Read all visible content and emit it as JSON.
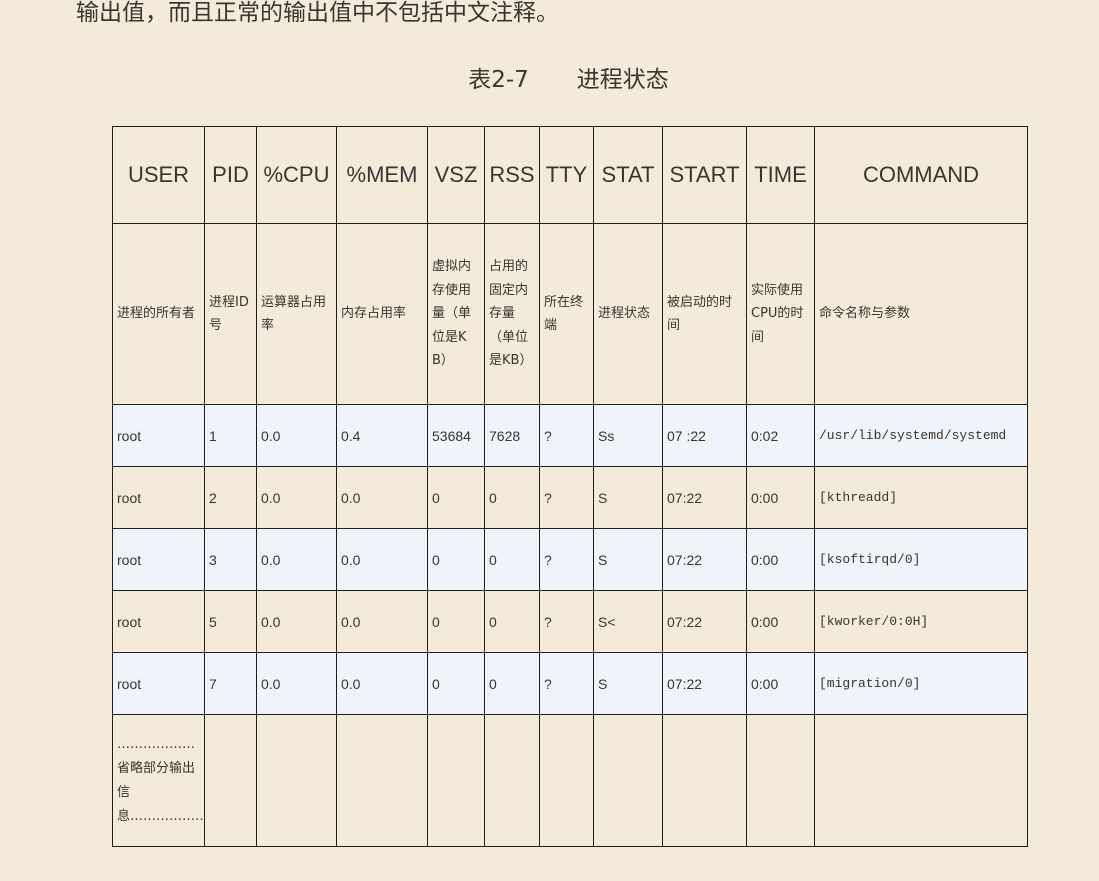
{
  "intro_text": "输出值，而且正常的输出值中不包括中文注释。",
  "caption": {
    "number": "表2-7",
    "title": "进程状态"
  },
  "table": {
    "headers": [
      "USER",
      "PID",
      "%CPU",
      "%MEM",
      "VSZ",
      "RSS",
      "TTY",
      "STAT",
      "START",
      "TIME",
      "COMMAND"
    ],
    "descriptions": [
      "进程的所有者",
      "进程ID号",
      "运算器占用率",
      "内存占用率",
      "虚拟内存使用量（单位是KB）",
      "占用的固定内存量（单位是KB）",
      "所在终端",
      "进程状态",
      "被启动的时间",
      "实际使用CPU的时间",
      "命令名称与参数"
    ],
    "rows": [
      [
        "root",
        "1",
        "0.0",
        "0.4",
        "53684",
        "7628",
        "?",
        "Ss",
        "07 :22",
        "0:02",
        "/usr/lib/systemd/systemd"
      ],
      [
        "root",
        "2",
        "0.0",
        "0.0",
        "0",
        "0",
        "?",
        "S",
        "07:22",
        "0:00",
        "[kthreadd]"
      ],
      [
        "root",
        "3",
        "0.0",
        "0.0",
        "0",
        "0",
        "?",
        "S",
        "07:22",
        "0:00",
        "[ksoftirqd/0]"
      ],
      [
        "root",
        "5",
        "0.0",
        "0.0",
        "0",
        "0",
        "?",
        "S<",
        "07:22",
        "0:00",
        "[kworker/0:0H]"
      ],
      [
        "root",
        "7",
        "0.0",
        "0.0",
        "0",
        "0",
        "?",
        "S",
        "07:22",
        "0:00",
        "[migration/0]"
      ]
    ],
    "omitted_note": "………………省略部分输出信息………………"
  }
}
